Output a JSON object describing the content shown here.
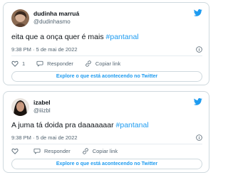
{
  "tweets": [
    {
      "name": "dudinha marruá",
      "handle": "@dudinhasmo",
      "text": "eita que a onça quer é mais ",
      "hashtag": "#pantanal",
      "timestamp": "9:38 PM · 5 de mai de 2022",
      "like_count": "1",
      "reply_label": "Responder",
      "copy_label": "Copiar link",
      "cta_label": "Explore o que está acontecendo no Twitter"
    },
    {
      "name": "izabel",
      "handle": "@iiizbl",
      "text": "A juma tá doida pra daaaaaaar  ",
      "hashtag": "#pantanal",
      "timestamp": "9:38 PM · 5 de mai de 2022",
      "reply_label": "Responder",
      "copy_label": "Copiar link",
      "cta_label": "Explore o que está acontecendo no Twitter"
    }
  ],
  "colors": {
    "accent": "#1d9bf0",
    "muted": "#536471",
    "border": "#cfd9de"
  },
  "icons": [
    "twitter-bird-icon",
    "info-icon",
    "heart-icon",
    "reply-icon",
    "link-icon"
  ]
}
